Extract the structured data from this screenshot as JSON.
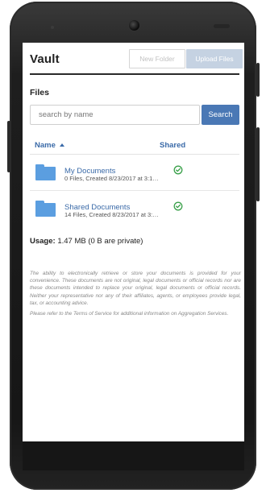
{
  "header": {
    "title": "Vault",
    "new_folder_label": "New Folder",
    "upload_files_label": "Upload Files"
  },
  "files_section": {
    "heading": "Files",
    "search_placeholder": "search by name",
    "search_value": "",
    "search_button_label": "Search"
  },
  "table": {
    "columns": [
      "Name",
      "Shared"
    ],
    "rows": [
      {
        "name": "My Documents",
        "meta": "0 Files, Created 8/23/2017 at 3:1…",
        "shared": true
      },
      {
        "name": "Shared Documents",
        "meta": "14 Files, Created 8/23/2017 at 3:…",
        "shared": true
      }
    ]
  },
  "usage": {
    "label": "Usage:",
    "value": "1.47 MB (0 B are private)"
  },
  "disclaimer": [
    "The ability to electronically retrieve or store your documents is provided for your convenience. These documents are not original, legal documents or official records nor are these documents intended to replace your original, legal documents or official records. Neither your representative nor any of their affiliates, agents, or employees provide legal, tax, or accounting advice.",
    "Please refer to the Terms of Service for additional information on Aggregation Services."
  ],
  "colors": {
    "accent": "#4a78b5",
    "link": "#3a6aa8",
    "folder": "#5b9ee0",
    "shared_check": "#3aa04a"
  },
  "icons": {
    "folder": "folder-icon",
    "shared": "check-circle-icon",
    "sort": "sort-ascending-icon"
  }
}
